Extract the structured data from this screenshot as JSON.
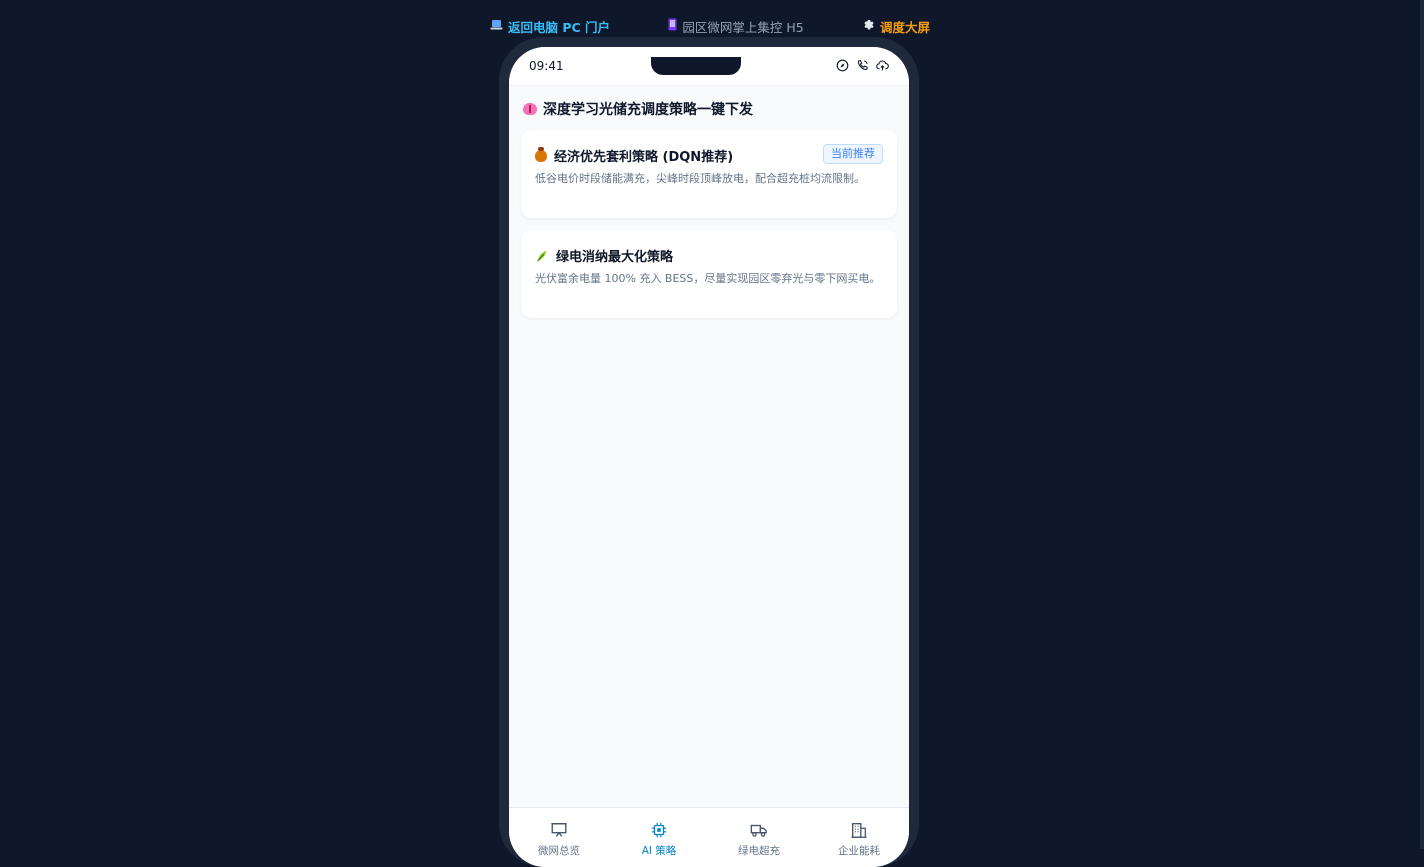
{
  "topbar": {
    "pc_link": "返回电脑 PC 门户",
    "h5_label": "园区微网掌上集控 H5",
    "screen_link": "调度大屏",
    "pc_icon": "laptop-icon",
    "h5_icon": "mobile-phone-icon",
    "screen_icon": "gear-icon"
  },
  "status_bar": {
    "time": "09:41",
    "icons": [
      "compass-icon",
      "phone-icon",
      "cloud-upload-icon"
    ]
  },
  "section": {
    "title": "深度学习光储充调度策略一键下发",
    "icon": "brain-icon"
  },
  "strategies": [
    {
      "icon": "money-bag-icon",
      "title": "经济优先套利策略 (DQN推荐)",
      "badge": "当前推荐",
      "description": "低谷电价时段储能满充，尖峰时段顶峰放电，配合超充桩均流限制。"
    },
    {
      "icon": "herb-icon",
      "title": "绿电消纳最大化策略",
      "description": "光伏富余电量 100% 充入 BESS，尽量实现园区零弃光与零下网买电。"
    }
  ],
  "tabbar": {
    "tabs": [
      {
        "label": "微网总览",
        "icon": "presentation-icon",
        "active": false
      },
      {
        "label": "AI 策略",
        "icon": "cpu-chip-icon",
        "active": true
      },
      {
        "label": "绿电超充",
        "icon": "truck-icon",
        "active": false
      },
      {
        "label": "企业能耗",
        "icon": "building-icon",
        "active": false
      }
    ]
  },
  "colors": {
    "page_bg": "#0f172a",
    "phone_bg": "#f8fafc",
    "accent_blue": "#38bdf8",
    "accent_orange": "#f59e0b",
    "active_tab": "#0284c7",
    "badge_text": "#3b82f6"
  }
}
